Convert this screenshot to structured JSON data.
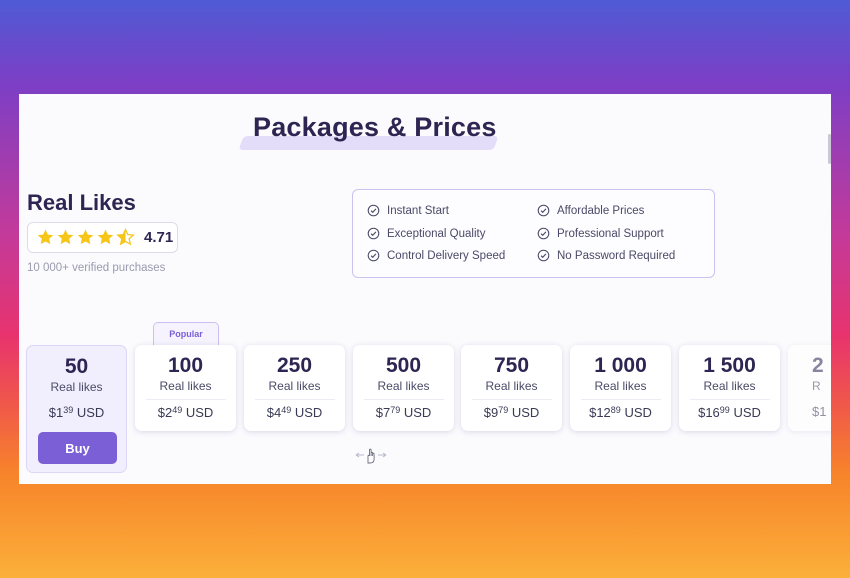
{
  "page": {
    "title": "Packages & Prices"
  },
  "product": {
    "name": "Real Likes",
    "rating": "4.71",
    "stars_filled": 4.5,
    "stars_total": 5,
    "verified_text": "10 000+ verified purchases"
  },
  "features": [
    "Instant Start",
    "Affordable Prices",
    "Exceptional Quality",
    "Professional Support",
    "Control Delivery Speed",
    "No Password Required"
  ],
  "popular_badge": "Popular",
  "buy_label": "Buy",
  "packages": [
    {
      "count": "50",
      "unit": "Real likes",
      "price_main": "$1",
      "price_cents": "39",
      "currency": "USD"
    },
    {
      "count": "100",
      "unit": "Real likes",
      "price_main": "$2",
      "price_cents": "49",
      "currency": "USD"
    },
    {
      "count": "250",
      "unit": "Real likes",
      "price_main": "$4",
      "price_cents": "49",
      "currency": "USD"
    },
    {
      "count": "500",
      "unit": "Real likes",
      "price_main": "$7",
      "price_cents": "79",
      "currency": "USD"
    },
    {
      "count": "750",
      "unit": "Real likes",
      "price_main": "$9",
      "price_cents": "79",
      "currency": "USD"
    },
    {
      "count": "1 000",
      "unit": "Real likes",
      "price_main": "$12",
      "price_cents": "89",
      "currency": "USD"
    },
    {
      "count": "1 500",
      "unit": "Real likes",
      "price_main": "$16",
      "price_cents": "99",
      "currency": "USD"
    },
    {
      "count": "2",
      "unit": "R",
      "price_main": "$1",
      "price_cents": "",
      "currency": ""
    }
  ],
  "colors": {
    "accent": "#7a5fd6",
    "heading": "#2e2552",
    "star": "#f5c518"
  },
  "icons": {
    "feature": "check-circle-icon",
    "star": "star-icon",
    "drag": "drag-hand-icon"
  }
}
